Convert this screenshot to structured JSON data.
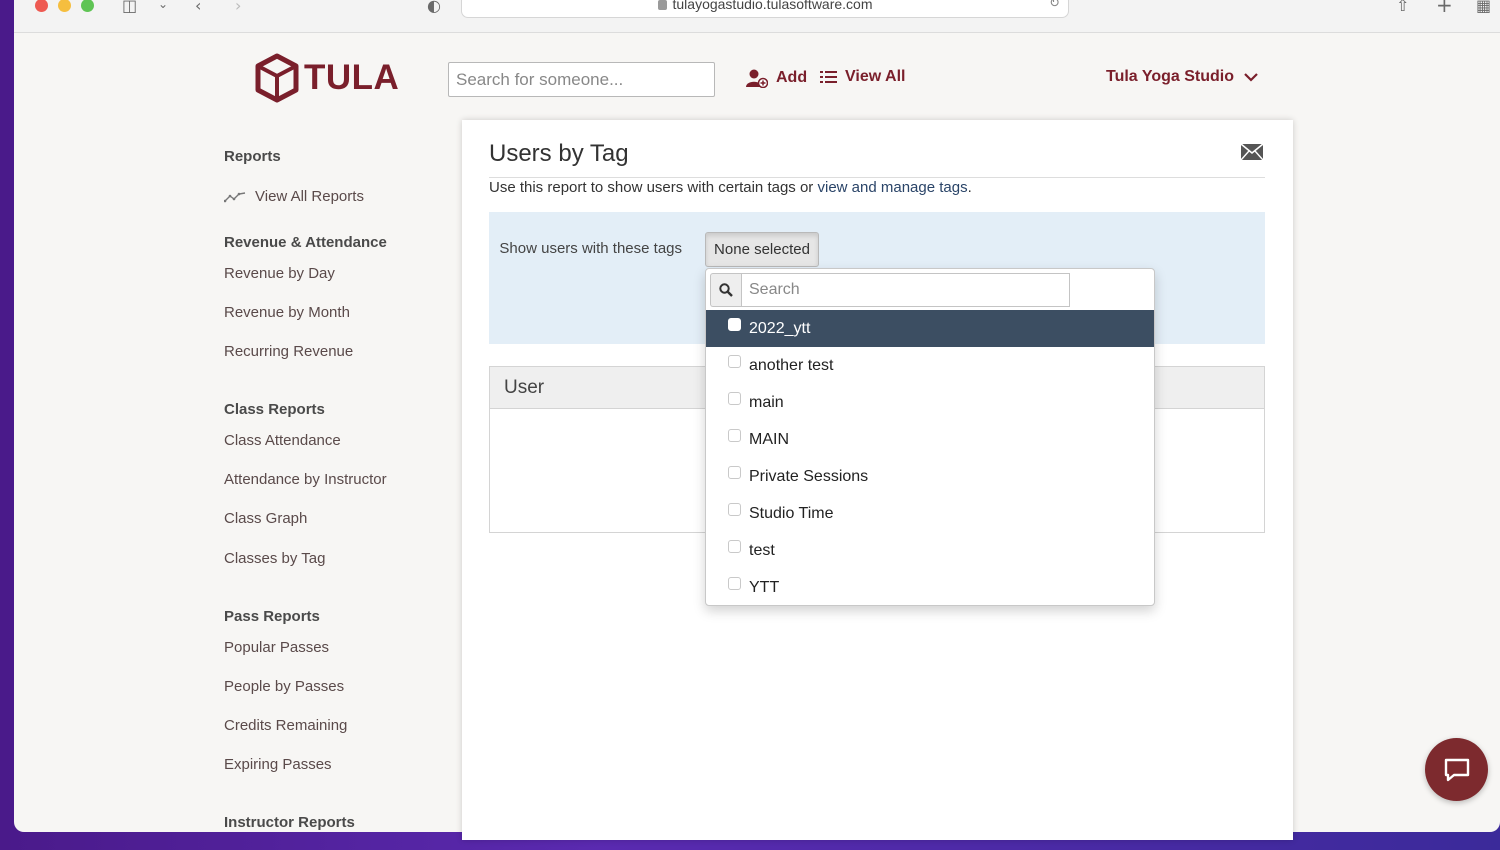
{
  "browser": {
    "url": "tulayogastudio.tulasoftware.com"
  },
  "brand": {
    "name": "TULA",
    "color": "#7a1f2b"
  },
  "topnav": {
    "search_placeholder": "Search for someone...",
    "add_label": "Add",
    "view_all_label": "View All",
    "studio_label": "Tula Yoga Studio"
  },
  "sidebar": {
    "reports_heading": "Reports",
    "view_all_reports": "View All Reports",
    "sections": [
      {
        "heading": "Revenue & Attendance",
        "items": [
          "Revenue by Day",
          "Revenue by Month",
          "Recurring Revenue"
        ]
      },
      {
        "heading": "Class Reports",
        "items": [
          "Class Attendance",
          "Attendance by Instructor",
          "Class Graph",
          "Classes by Tag"
        ]
      },
      {
        "heading": "Pass Reports",
        "items": [
          "Popular Passes",
          "People by Passes",
          "Credits Remaining",
          "Expiring Passes"
        ]
      },
      {
        "heading": "Instructor Reports",
        "items": []
      }
    ]
  },
  "report": {
    "title": "Users by Tag",
    "description_prefix": "Use this report to show users with certain tags or ",
    "description_link": "view and manage tags",
    "description_suffix": ".",
    "filter_label": "Show users with these tags",
    "selected_value": "None selected",
    "table_header_user": "User"
  },
  "tag_dropdown": {
    "search_placeholder": "Search",
    "options": [
      "2022_ytt",
      "another test",
      "main",
      "MAIN",
      "Private Sessions",
      "Studio Time",
      "test",
      "YTT"
    ],
    "highlighted_index": 0,
    "checked": [
      false,
      false,
      false,
      false,
      false,
      false,
      false,
      false
    ]
  }
}
